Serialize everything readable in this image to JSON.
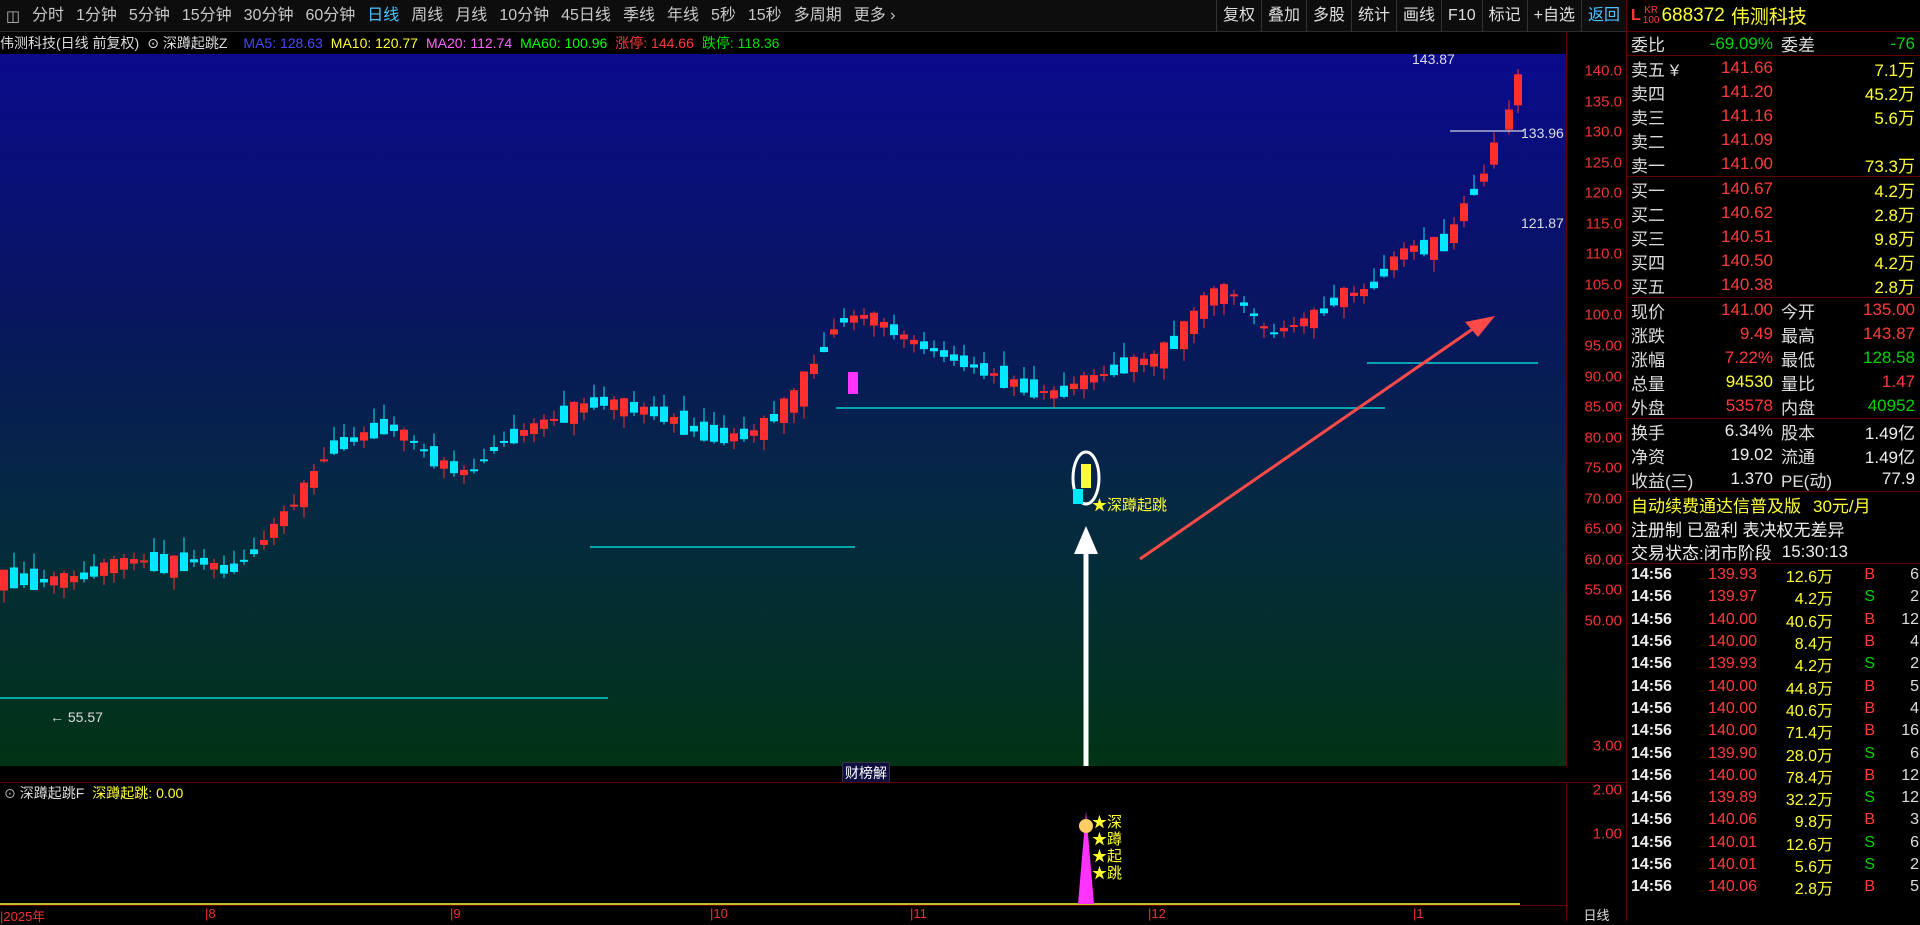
{
  "toolbar": {
    "periods": [
      "分时",
      "1分钟",
      "5分钟",
      "15分钟",
      "30分钟",
      "60分钟",
      "日线",
      "周线",
      "月线",
      "10分钟",
      "45日线",
      "季线",
      "年线",
      "5秒",
      "15秒",
      "多周期",
      "更多"
    ],
    "active": "日线",
    "right_buttons": [
      "复权",
      "叠加",
      "多股",
      "统计",
      "画线",
      "F10",
      "标记",
      "+自选",
      "返回"
    ]
  },
  "stock": {
    "code": "688372",
    "name": "伟测科技",
    "badge": "KR",
    "badge_sub": "100"
  },
  "chart_info": {
    "title": "伟测科技(日线 前复权)",
    "indicator": "深蹲起跳Z",
    "ma5": "MA5: 128.63",
    "ma10": "MA10: 120.77",
    "ma20": "MA20: 112.74",
    "ma60": "MA60: 100.96",
    "zt": "涨停: 144.66",
    "dt": "跌停: 118.36"
  },
  "colors": {
    "up": "#ff2f2f",
    "down": "#00e8ff",
    "bg_top": "#0a0a8c",
    "bg_bottom": "#013315"
  },
  "main_axis": [
    "140.0",
    "135.0",
    "130.0",
    "125.0",
    "120.0",
    "115.0",
    "110.0",
    "105.0",
    "100.0",
    "95.00",
    "90.00",
    "85.00",
    "80.00",
    "75.00",
    "70.00",
    "65.00",
    "60.00",
    "55.00",
    "50.00"
  ],
  "annotations": {
    "high": "143.87",
    "low": "55.57",
    "level1": "133.96",
    "level2": "121.87",
    "signal": "深蹲起跳",
    "banner": "财榜解"
  },
  "sub": {
    "title": "深蹲起跳F",
    "label": "深蹲起跳: 0.00",
    "axis": [
      "3.00",
      "2.00",
      "1.00"
    ],
    "signal_chars": [
      "深",
      "蹲",
      "起",
      "跳"
    ]
  },
  "date_axis": {
    "labels": [
      "2025年",
      "8",
      "9",
      "10",
      "11",
      "12",
      "1"
    ],
    "period": "日线"
  },
  "quote": {
    "weibi": {
      "label": "委比",
      "value": "-69.09%",
      "label2": "委差",
      "value2": "-76"
    },
    "sells": [
      {
        "label": "卖五",
        "sym": "¥",
        "price": "141.66",
        "vol": "7.1万"
      },
      {
        "label": "卖四",
        "price": "141.20",
        "vol": "45.2万"
      },
      {
        "label": "卖三",
        "price": "141.16",
        "vol": "5.6万"
      },
      {
        "label": "卖二",
        "price": "141.09",
        "vol": ""
      },
      {
        "label": "卖一",
        "price": "141.00",
        "vol": "73.3万"
      }
    ],
    "buys": [
      {
        "label": "买一",
        "price": "140.67",
        "vol": "4.2万"
      },
      {
        "label": "买二",
        "price": "140.62",
        "vol": "2.8万"
      },
      {
        "label": "买三",
        "price": "140.51",
        "vol": "9.8万"
      },
      {
        "label": "买四",
        "price": "140.50",
        "vol": "4.2万"
      },
      {
        "label": "买五",
        "price": "140.38",
        "vol": "2.8万"
      }
    ],
    "stats": [
      {
        "l1": "现价",
        "v1": "141.00",
        "l2": "今开",
        "v2": "135.00"
      },
      {
        "l1": "涨跌",
        "v1": "9.49",
        "l2": "最高",
        "v2": "143.87"
      },
      {
        "l1": "涨幅",
        "v1": "7.22%",
        "l2": "最低",
        "v2": "128.58"
      },
      {
        "l1": "总量",
        "v1": "94530",
        "l2": "量比",
        "v2": "1.47"
      },
      {
        "l1": "外盘",
        "v1": "53578",
        "l2": "内盘",
        "v2": "40952"
      }
    ],
    "stats2": [
      {
        "l1": "换手",
        "v1": "6.34%",
        "l2": "股本",
        "v2": "1.49亿"
      },
      {
        "l1": "净资",
        "v1": "19.02",
        "l2": "流通",
        "v2": "1.49亿"
      },
      {
        "l1": "收益(三)",
        "v1": "1.370",
        "l2": "PE(动)",
        "v2": "77.9"
      }
    ],
    "promo1": "自动续费通达信普及版",
    "promo1_price": "30元/月",
    "promo2": "注册制 已盈利 表决权无差异",
    "status_label": "交易状态:",
    "status_value": "闭市阶段",
    "status_time": "15:30:13"
  },
  "ticks": [
    {
      "t": "14:56",
      "p": "139.93",
      "v": "12.6万",
      "bs": "B",
      "n": "6"
    },
    {
      "t": "14:56",
      "p": "139.97",
      "v": "4.2万",
      "bs": "S",
      "n": "2"
    },
    {
      "t": "14:56",
      "p": "140.00",
      "v": "40.6万",
      "bs": "B",
      "n": "12"
    },
    {
      "t": "14:56",
      "p": "140.00",
      "v": "8.4万",
      "bs": "B",
      "n": "4"
    },
    {
      "t": "14:56",
      "p": "139.93",
      "v": "4.2万",
      "bs": "S",
      "n": "2"
    },
    {
      "t": "14:56",
      "p": "140.00",
      "v": "44.8万",
      "bs": "B",
      "n": "5"
    },
    {
      "t": "14:56",
      "p": "140.00",
      "v": "40.6万",
      "bs": "B",
      "n": "4"
    },
    {
      "t": "14:56",
      "p": "140.00",
      "v": "71.4万",
      "bs": "B",
      "n": "16"
    },
    {
      "t": "14:56",
      "p": "139.90",
      "v": "28.0万",
      "bs": "S",
      "n": "6"
    },
    {
      "t": "14:56",
      "p": "140.00",
      "v": "78.4万",
      "bs": "B",
      "n": "12"
    },
    {
      "t": "14:56",
      "p": "139.89",
      "v": "32.2万",
      "bs": "S",
      "n": "12"
    },
    {
      "t": "14:56",
      "p": "140.06",
      "v": "9.8万",
      "bs": "B",
      "n": "3"
    },
    {
      "t": "14:56",
      "p": "140.01",
      "v": "12.6万",
      "bs": "S",
      "n": "6"
    },
    {
      "t": "14:56",
      "p": "140.01",
      "v": "5.6万",
      "bs": "S",
      "n": "2"
    },
    {
      "t": "14:56",
      "p": "140.06",
      "v": "2.8万",
      "bs": "B",
      "n": "5"
    }
  ]
}
